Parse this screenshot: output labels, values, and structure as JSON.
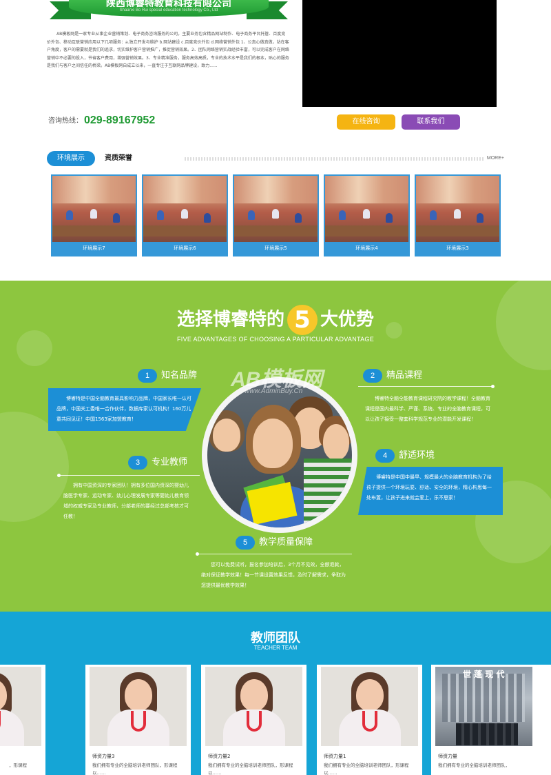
{
  "about": {
    "ribbon_title": "陕西博睿特教育科技有限公司",
    "ribbon_sub": "Shaanxi Bo Rui special education technology Co., Ltd",
    "text": "AB模板网是一家专业从事企业营销策划、电子商务咨询服务的公司，主要业务包含精品网站制作、电子商务平台托管、百度竞价外包、移动互联营销应用以下几项服务：a.独立开发与维护 b.网站建设 c.百度竞价外包 d.网络营销外包 1、公真心做真做，站在客户角度，客户的需要就是我们的追求，切实维护客户营销推广，推促营销效果。2、团队网络营销实战经验丰富，可以完成客户在网络营销中不必要的投入，节省客户费用，增强营销效果。3、专业精准服务，服务高效高质，专业的技术水平是我们的根本，贴心的服务是我们与客户之间信任的桥梁。AB模板网自成立以来，一直专注于互联网品牌建设，致力......",
    "hotline_label": "咨询热线：",
    "hotline_number": "029-89167952",
    "btn_consult": "在线咨询",
    "btn_contact": "联系我们"
  },
  "env": {
    "tab_active": "环境展示",
    "tab_2": "资质荣誉",
    "more": "MORE+",
    "photos": [
      "环境展示7",
      "环境展示6",
      "环境展示5",
      "环境展示4",
      "环境展示3"
    ]
  },
  "adv": {
    "title_pre": "选择博睿特的",
    "title_num": "5",
    "title_post": "大优势",
    "subtitle": "FIVE ADVANTAGES OF CHOOSING A PARTICULAR ADVANTAGE",
    "watermark": "AB模板网",
    "watermark_url": "www.AdminBuy.Cn",
    "features": [
      {
        "num": "1",
        "title": "知名品牌",
        "text": "博睿特是中国全脑教育最具影响力品牌，中国家长唯一认可品牌，中国关工委唯一合作伙伴，数据库家认可机构！160万儿童共同见证！中国1563家加盟教育！"
      },
      {
        "num": "2",
        "title": "精品课程",
        "text": "博睿特全脑全能教育课程研究院的教学课程！全脑教育课程是国内最科学、严谨、系统、专业的全脑教育课程，可以让孩子接受一整套科学规范专业的潜能开发课程！"
      },
      {
        "num": "3",
        "title": "专业教师",
        "text": "拥有中国资深的专家团队！拥有多位国内资深的婴幼儿脑医学专家、运动专家、幼儿心理发展专家等婴幼儿教育领域的权威专家及专业教师，分部老师的要经过总部考核才可任教！"
      },
      {
        "num": "4",
        "title": "舒适环境",
        "text": "博睿特是中国中最早、规模最大的全脑教育机构为了给孩子提供一个环境玩耍、舒适、安全的环境，精心构思每一处布置，让孩子进来就会爱上，乐不思家！"
      },
      {
        "num": "5",
        "title": "教学质量保障",
        "text": "您可以免费试听，报名参加培训后，3个月不见效，全额退款，绝对保证教学效果！每一节课设置效果反馈，及时了解需求，争取为您提供最优教学效果！"
      }
    ]
  },
  "team": {
    "title": "教师团队",
    "subtitle": "TEACHER TEAM",
    "members": [
      {
        "name": "",
        "desc": "，形课程"
      },
      {
        "name": "师资力量3",
        "desc": "我们拥有专业的全脑培训老师团队，形课程以……"
      },
      {
        "name": "师资力量2",
        "desc": "我们拥有专业的全脑培训老师团队，形课程以……"
      },
      {
        "name": "师资力量1",
        "desc": "我们拥有专业的全脑培训老师团队，形课程以……"
      },
      {
        "name": "师资力量",
        "desc": "我们拥有专业的全脑培训老师团队，"
      }
    ],
    "building_sign": "世 蓬 现 代"
  }
}
